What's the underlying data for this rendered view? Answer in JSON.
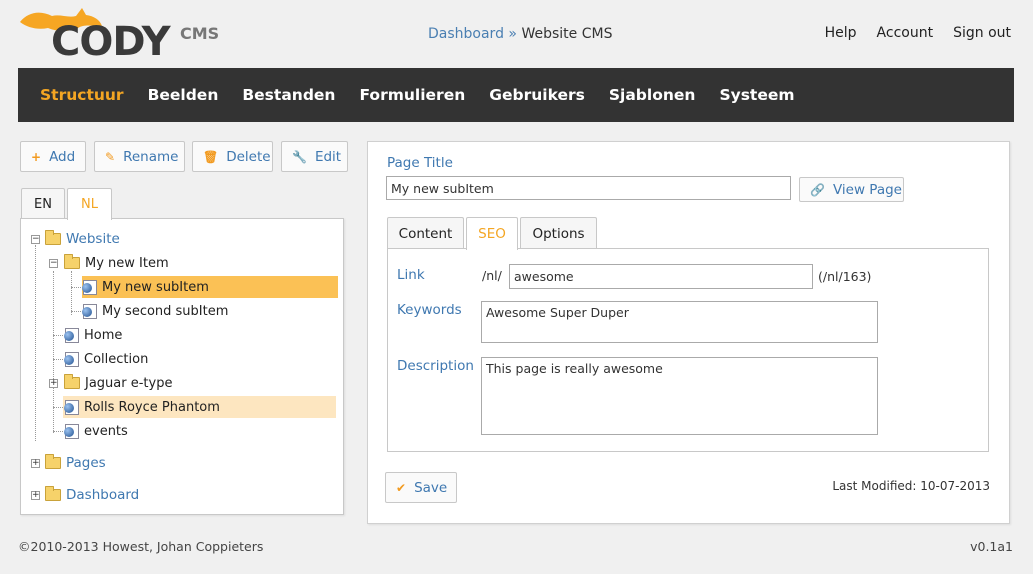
{
  "header": {
    "brand": "CODY",
    "brand_sub": "CMS",
    "breadcrumb": {
      "link": "Dashboard",
      "separator": "»",
      "current": "Website CMS"
    },
    "top_links": [
      "Help",
      "Account",
      "Sign out"
    ]
  },
  "nav": {
    "items": [
      "Structuur",
      "Beelden",
      "Bestanden",
      "Formulieren",
      "Gebruikers",
      "Sjablonen",
      "Systeem"
    ],
    "active": "Structuur"
  },
  "toolbar": {
    "add": "Add",
    "rename": "Rename",
    "delete": "Delete",
    "edit": "Edit"
  },
  "languages": [
    "EN",
    "NL"
  ],
  "tree": {
    "website": "Website",
    "my_new_item": "My new Item",
    "my_new_subitem": "My new subItem",
    "my_second_subitem": "My second subItem",
    "home": "Home",
    "collection": "Collection",
    "jaguar": "Jaguar e-type",
    "rolls": "Rolls Royce Phantom",
    "events": "events",
    "pages": "Pages",
    "dashboard": "Dashboard"
  },
  "editor": {
    "page_title_label": "Page Title",
    "page_title_value": "My new subItem",
    "view_page": "View Page",
    "tabs": [
      "Content",
      "SEO",
      "Options"
    ],
    "active_tab": "SEO",
    "link_label": "Link",
    "link_prefix": "/nl/",
    "link_value": "awesome",
    "link_suffix": "(/nl/163)",
    "keywords_label": "Keywords",
    "keywords_value": "Awesome Super Duper",
    "description_label": "Description",
    "description_value": "This page is really awesome",
    "save": "Save",
    "last_modified": "Last Modified: 10-07-2013"
  },
  "footer": {
    "copyright": "©2010-2013 Howest, Johan Coppieters",
    "version": "v0.1a1"
  },
  "colors": {
    "accent": "#f4a623",
    "link": "#3f78b0",
    "nav_bg": "#333333",
    "selected": "#fbc155"
  }
}
